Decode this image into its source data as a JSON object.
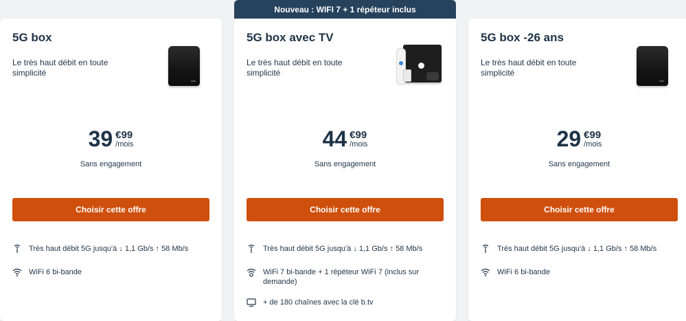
{
  "ribbon": "Nouveau : WIFI 7 + 1 répéteur inclus",
  "offers": [
    {
      "title": "5G box",
      "subtitle": "Le très haut débit en toute simplicité",
      "price_int": "39",
      "price_cents": "€99",
      "price_period": "/mois",
      "engagement": "Sans engagement",
      "cta": "Choisir cette offre",
      "features": [
        {
          "icon": "antenna-icon",
          "text": "Très haut débit 5G jusqu'à ↓ 1,1 Gb/s  ↑ 58 Mb/s"
        },
        {
          "icon": "wifi-icon",
          "text": "WiFi 6 bi-bande"
        }
      ]
    },
    {
      "title": "5G box avec TV",
      "subtitle": "Le très haut débit en toute simplicité",
      "price_int": "44",
      "price_cents": "€99",
      "price_period": "/mois",
      "engagement": "Sans engagement",
      "cta": "Choisir cette offre",
      "features": [
        {
          "icon": "antenna-icon",
          "text": "Très haut débit 5G jusqu'à ↓ 1,1 Gb/s  ↑ 58 Mb/s"
        },
        {
          "icon": "wifi-repeater-icon",
          "text": "WiFi 7 bi-bande + 1 répéteur WiFi 7 (inclus sur demande)"
        },
        {
          "icon": "tv-icon",
          "text": "+ de 180 chaînes avec la clé b.tv"
        }
      ]
    },
    {
      "title": "5G box -26 ans",
      "subtitle": "Le très haut débit en toute simplicité",
      "price_int": "29",
      "price_cents": "€99",
      "price_period": "/mois",
      "engagement": "Sans engagement",
      "cta": "Choisir cette offre",
      "features": [
        {
          "icon": "antenna-icon",
          "text": "Très haut débit 5G jusqu'à ↓ 1,1 Gb/s  ↑ 58 Mb/s"
        },
        {
          "icon": "wifi-icon",
          "text": "WiFi 6 bi-bande"
        }
      ]
    }
  ],
  "colors": {
    "primary_text": "#1e3347",
    "cta": "#cf4f0c",
    "ribbon": "#26425c"
  }
}
